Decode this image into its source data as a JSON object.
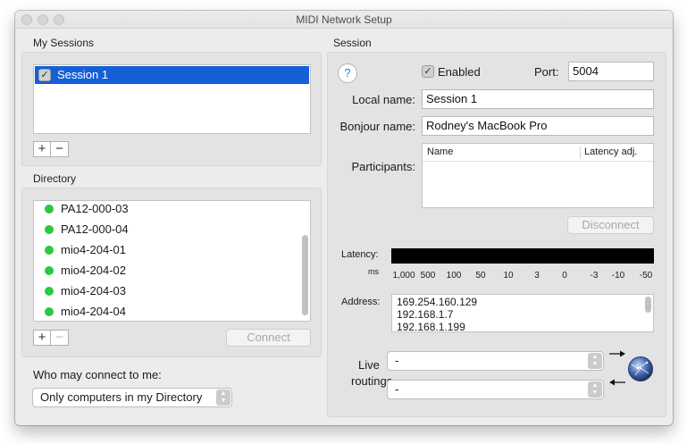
{
  "window": {
    "title": "MIDI Network Setup"
  },
  "my_sessions": {
    "label": "My Sessions",
    "sessions": [
      {
        "name": "Session 1",
        "checked": true
      }
    ],
    "add_label": "+",
    "remove_label": "−"
  },
  "directory": {
    "label": "Directory",
    "items": [
      "PA12-000-03",
      "PA12-000-04",
      "mio4-204-01",
      "mio4-204-02",
      "mio4-204-03",
      "mio4-204-04"
    ],
    "status_color": "#2bc840",
    "add_label": "+",
    "remove_label": "−",
    "connect_label": "Connect"
  },
  "who_may_connect": {
    "label": "Who may connect to me:",
    "value": "Only computers in my Directory"
  },
  "session": {
    "label": "Session",
    "help_label": "?",
    "enabled_label": "Enabled",
    "enabled_checked": true,
    "port_label": "Port:",
    "port_value": "5004",
    "local_name_label": "Local name:",
    "local_name_value": "Session 1",
    "bonjour_name_label": "Bonjour name:",
    "bonjour_name_value": "Rodney's MacBook Pro",
    "participants_label": "Participants:",
    "participants_columns": [
      "Name",
      "Latency adj."
    ],
    "disconnect_label": "Disconnect",
    "latency_label": "Latency:",
    "latency_unit": "ms",
    "latency_scale": [
      "1,000",
      "500",
      "100",
      "50",
      "10",
      "3",
      "0",
      "-3",
      "-10",
      "-50"
    ],
    "address_label": "Address:",
    "addresses": [
      "169.254.160.129",
      "192.168.1.7",
      "192.168.1.199"
    ],
    "live_label": "Live",
    "routings_label": "routings",
    "routing_in_value": "-",
    "routing_out_value": "-"
  },
  "colors": {
    "selection": "#1560d6",
    "accent_green": "#2bc840"
  }
}
